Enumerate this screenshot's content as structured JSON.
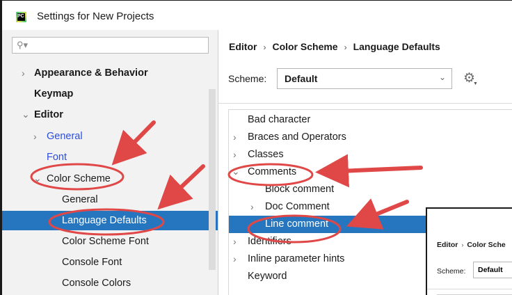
{
  "window": {
    "title": "Settings for New Projects",
    "app_icon_text": "PC"
  },
  "search": {
    "placeholder": "",
    "icon": "search-icon"
  },
  "tree": [
    {
      "label": "Appearance & Behavior"
    },
    {
      "label": "Keymap"
    },
    {
      "label": "Editor"
    },
    {
      "label": "General"
    },
    {
      "label": "Font"
    },
    {
      "label": "Color Scheme"
    },
    {
      "label": "General"
    },
    {
      "label": "Language Defaults"
    },
    {
      "label": "Color Scheme Font"
    },
    {
      "label": "Console Font"
    },
    {
      "label": "Console Colors"
    }
  ],
  "breadcrumb": [
    "Editor",
    "Color Scheme",
    "Language Defaults"
  ],
  "scheme": {
    "label": "Scheme:",
    "value": "Default"
  },
  "list": [
    {
      "label": "Bad character"
    },
    {
      "label": "Braces and Operators"
    },
    {
      "label": "Classes"
    },
    {
      "label": "Comments"
    },
    {
      "label": "Block comment"
    },
    {
      "label": "Doc Comment"
    },
    {
      "label": "Line comment"
    },
    {
      "label": "Identifiers"
    },
    {
      "label": "Inline parameter hints"
    },
    {
      "label": "Keyword"
    }
  ],
  "inset": {
    "breadcrumb": [
      "Editor",
      "Color Sche"
    ],
    "scheme_label": "Scheme:",
    "scheme_value": "Default"
  },
  "colors": {
    "selection": "#2675bf",
    "annotation": "#e04848",
    "link": "#2a4de0"
  }
}
